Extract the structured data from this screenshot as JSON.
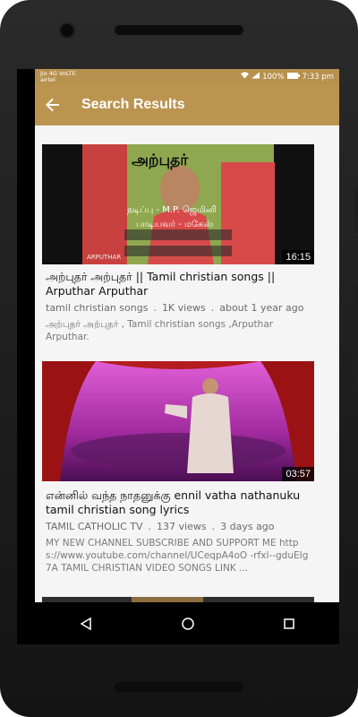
{
  "status": {
    "carrier": "Jio 4G VoLTE",
    "carrier2": "airtel",
    "battery": "100%",
    "time": "7:33 pm"
  },
  "appbar": {
    "title": "Search Results",
    "back_icon": "arrow-left-icon"
  },
  "results": [
    {
      "duration": "16:15",
      "thumb_title": "அற்புதர்",
      "thumb_line1": "நடிப்பு - M.P. ஜெமினி",
      "thumb_line2": "பாடியவர் - மகேஸ்",
      "thumb_corner": "ARPUTHAR",
      "title": "அற்புதர் அற்புதர் || Tamil christian songs || Arputhar Arputhar",
      "channel": "tamil christian songs",
      "views": "1K views",
      "age": "about 1 year ago",
      "description": "அற்புதர் அற்புதர் , Tamil christian songs ,Arputhar Arputhar."
    },
    {
      "duration": "03:57",
      "title": "என்னில் வந்த நாதனுக்கு ennil vatha nathanuku tamil christian song lyrics",
      "channel": "TAMIL CATHOLIC TV",
      "views": "137 views",
      "age": "3 days ago",
      "description": "MY NEW CHANNEL SUBSCRIBE AND SUPPORT ME https://www.youtube.com/channel/UCeqpA4oO -rfxl--gduEIg7A TAMIL CHRISTIAN VIDEO SONGS LINK ..."
    }
  ],
  "colors": {
    "accent": "#bb954f",
    "background": "#f5f5f5"
  }
}
